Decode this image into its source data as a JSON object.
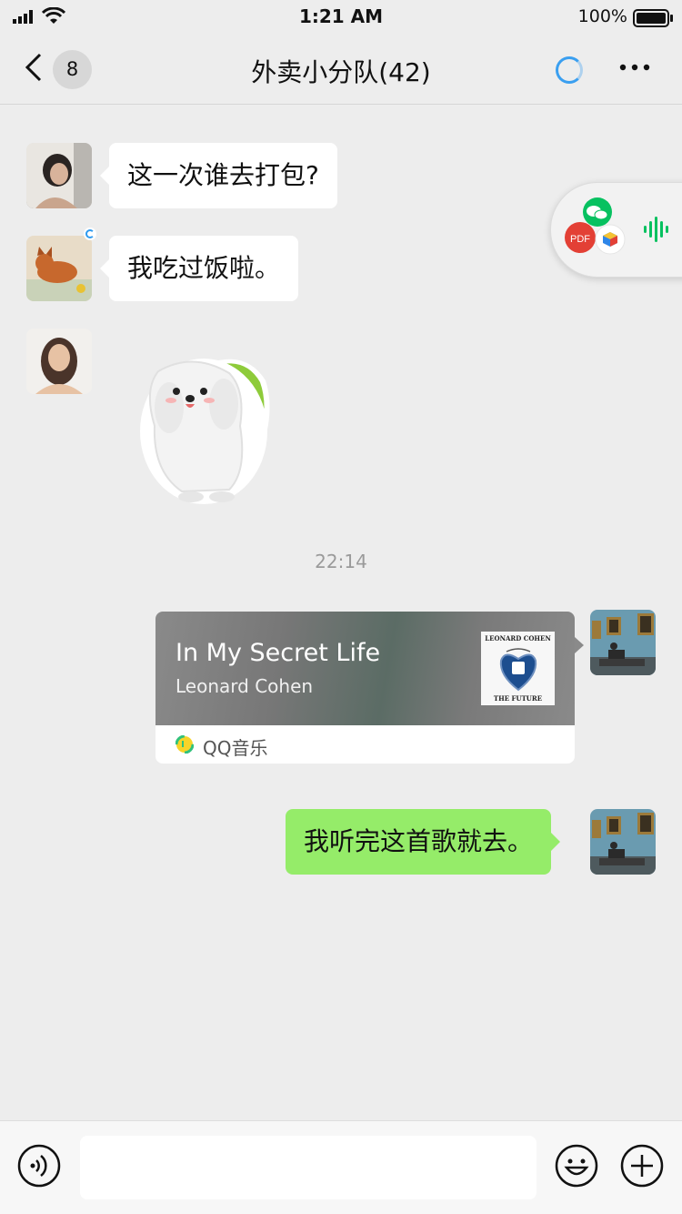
{
  "status": {
    "time": "1:21 AM",
    "battery_percent": "100%"
  },
  "nav": {
    "unread_count": "8",
    "title": "外卖小分队(42)"
  },
  "messages": {
    "m1": "这一次谁去打包?",
    "m2": "我吃过饭啦。",
    "timestamp": "22:14",
    "m5": "我听完这首歌就去。"
  },
  "music": {
    "title": "In My Secret Life",
    "artist": "Leonard Cohen",
    "app": "QQ音乐",
    "cover_top": "LEONARD COHEN",
    "cover_bottom": "THE FUTURE"
  },
  "floating_panel": {
    "pdf_label": "PDF"
  },
  "input": {
    "placeholder": ""
  },
  "colors": {
    "accent_green": "#95ec69",
    "wechat_green": "#07c160",
    "loading_blue": "#3a9ff0"
  },
  "icons": [
    "signal-icon",
    "wifi-icon",
    "battery-icon",
    "back-chevron-icon",
    "loading-icon",
    "more-icon",
    "wechat-icon",
    "pdf-icon",
    "cube-icon",
    "voice-wave-icon",
    "qq-music-icon",
    "voice-input-icon",
    "emoji-icon",
    "plus-icon"
  ]
}
